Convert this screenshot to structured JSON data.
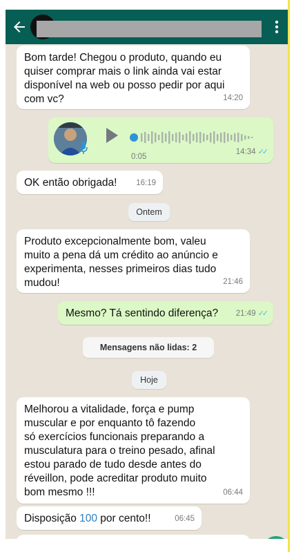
{
  "header": {
    "back_icon": "arrow-left-icon",
    "menu_icon": "more-vert-icon",
    "bg_color": "#075e54"
  },
  "messages": [
    {
      "type": "in",
      "text": "Bom tarde! Chegou o produto, quando eu\nquiser comprar mais o link ainda vai estar\ndisponível na web ou posso pedir por aqui\ncom vc?",
      "time": "14:20"
    },
    {
      "type": "out-voice",
      "duration": "0:05",
      "time": "14:34",
      "status": "read"
    },
    {
      "type": "in",
      "text": "OK então obrigada!",
      "time": "16:19"
    },
    {
      "type": "date",
      "text": "Ontem"
    },
    {
      "type": "in",
      "text": "Produto excepcionalmente bom, valeu\nmuito a pena dá um crédito ao anúncio e\nexperimenta, nesses primeiros dias tudo\nmudou!",
      "time": "21:46"
    },
    {
      "type": "out",
      "text": "Mesmo? Tá sentindo diferença?",
      "time": "21:49",
      "status": "read"
    },
    {
      "type": "unread",
      "text": "Mensagens não lidas: 2"
    },
    {
      "type": "date",
      "text": "Hoje"
    },
    {
      "type": "in",
      "text": "Melhorou a vitalidade, força e pump\nmuscular e por enquanto tô fazendo\nsó exercícios funcionais preparando a\nmusculatura para o treino pesado, afinal\nestou parado de tudo desde antes do\nréveillon, pode acreditar produto muito\nbom mesmo !!!",
      "time": "06:44"
    },
    {
      "type": "in",
      "text_before": "Disposição ",
      "highlight": "100",
      "text_after": " por cento!!",
      "time": "06:45"
    }
  ],
  "colors": {
    "chat_bg": "#e9e2d8",
    "incoming": "#ffffff",
    "outgoing": "#dcf8c6",
    "read_ticks": "#4fb6ec"
  }
}
